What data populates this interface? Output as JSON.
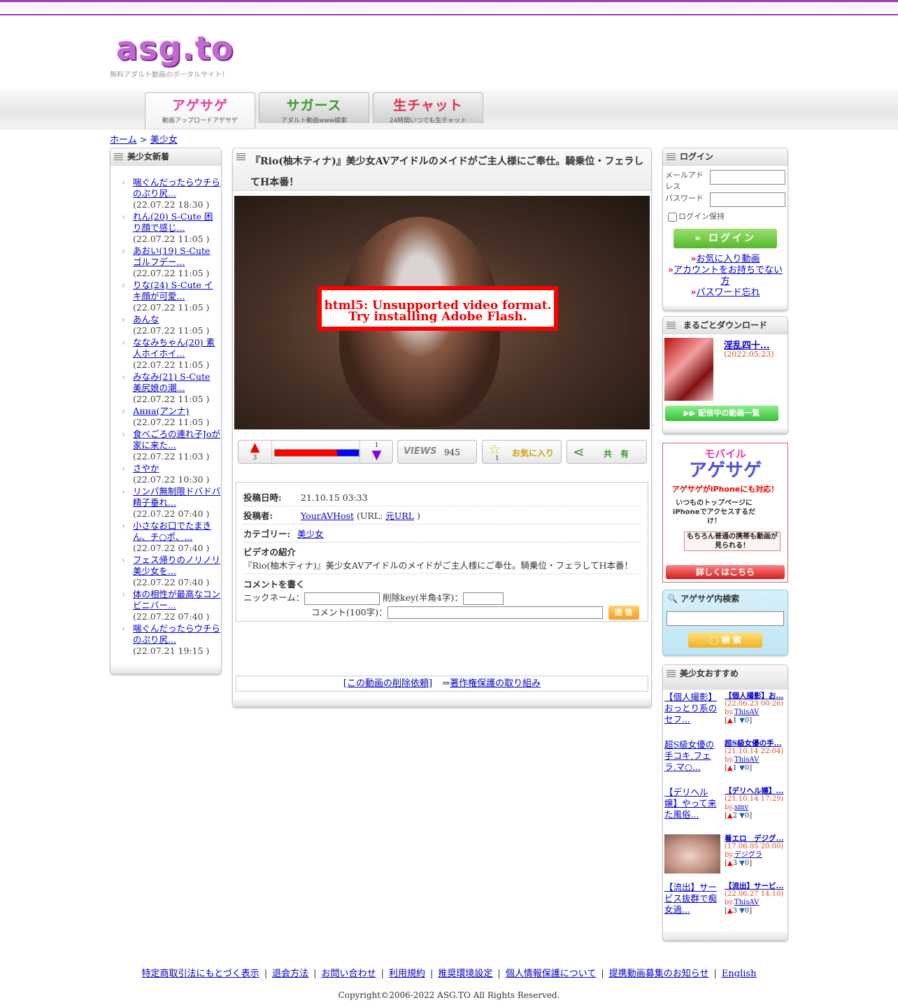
{
  "site": {
    "logo_text": "asg.to",
    "tagline": "無料アダルト動画のポータルサイト！"
  },
  "nav": {
    "tabs": [
      {
        "label": "アゲサゲ",
        "sub": "動画アップロードアゲサゲ"
      },
      {
        "label": "サガース",
        "sub": "アダルト動画www検索"
      },
      {
        "label": "生チャット",
        "sub": "24時間いつでも生チャット"
      }
    ]
  },
  "breadcrumb": {
    "home": "ホーム",
    "sep": ">",
    "current": "美少女"
  },
  "left": {
    "title": "美少女新着",
    "items": [
      {
        "title": "喘ぐんだったらウチらのぷり尻...",
        "date": "(22.07.22 18:30 )"
      },
      {
        "title": "れん(20) S-Cute 困り顔で感じ...",
        "date": "(22.07.22 11:05 )"
      },
      {
        "title": "あおい(19) S-Cute ゴルフデー...",
        "date": "(22.07.22 11:05 )"
      },
      {
        "title": "りな(24) S-Cute イキ顔が可愛...",
        "date": "(22.07.22 11:05 )"
      },
      {
        "title": "あんな",
        "date": "(22.07.22 11:05 )"
      },
      {
        "title": "ななみちゃん(20) 素人ホイホイ...",
        "date": "(22.07.22 11:05 )"
      },
      {
        "title": "みなみ(21) S-Cute 美尻娘の潮...",
        "date": "(22.07.22 11:05 )"
      },
      {
        "title": "Анна(アンナ)",
        "date": "(22.07.22 11:05 )"
      },
      {
        "title": "食べごろの連れ子Joが家に来た...",
        "date": "(22.07.22 11:03 )"
      },
      {
        "title": "さやか",
        "date": "(22.07.22 10:30 )"
      },
      {
        "title": "リンパ無制限ドバドバ精子垂れ...",
        "date": "(22.07.22 07:40 )"
      },
      {
        "title": "小さなお口でたまきん、チ○ポ、...",
        "date": "(22.07.22 07:40 )"
      },
      {
        "title": "フェス帰りのノリノリ美少女を...",
        "date": "(22.07.22 07:40 )"
      },
      {
        "title": "体の相性が最高なコンビニバー...",
        "date": "(22.07.22 07:40 )"
      },
      {
        "title": "喘ぐんだったらウチらのぷり尻...",
        "date": "(22.07.21 19:15 )"
      }
    ]
  },
  "video": {
    "title": "『Rio(柚木ティナ)』美少女AVアイドルのメイドがご主人様にご奉仕。騎乗位・フェラしてH本番！",
    "error_line1": "html5: Unsupported video format.",
    "error_line2": "Try installing Adobe Flash.",
    "up_count": "3",
    "down_count": "1",
    "views_label": "VIEWS",
    "views": "945",
    "fav_label": "お気に入り",
    "fav_count": "1",
    "share_label": "共　有",
    "rating_fraction_up": 0.74
  },
  "info": {
    "posted_label": "投稿日時:",
    "posted": "21.10.15 03:33",
    "poster_label": "投稿者:",
    "poster": "YourAVHost",
    "url_prefix": "(URL: ",
    "url_link": "元URL",
    "url_suffix": " )",
    "category_label": "カテゴリー:",
    "category": "美少女",
    "intro_label": "ビデオの紹介",
    "intro": "『Rio(柚木ティナ)』美少女AVアイドルのメイドがご主人様にご奉仕。騎乗位・フェラしてH本番！",
    "comment_label": "コメントを書く",
    "nick_label": "ニックネーム：",
    "delkey_label": "削除key(半角4字)：",
    "comment_field_label": "コメント(100字)：",
    "send_label": "送 信"
  },
  "bottom_links": {
    "delete_request": "[この動画の削除依頼]",
    "arrow": "⇒",
    "copyright_link": "著作権保護の取り組み"
  },
  "login": {
    "title": "ログイン",
    "email_label": "メールアドレス",
    "password_label": "パスワード",
    "keep_label": "ログイン保持",
    "button": "ログイン",
    "links": [
      "お気に入り動画",
      "アカウントをお持ちでない方",
      "パスワード忘れ"
    ]
  },
  "download": {
    "title": "まるごとダウンロード",
    "item_title": "淫乱四十...",
    "item_date": "(2022.05.23)",
    "button": "▶▶ 配信中の動画一覧"
  },
  "mobile_banner": {
    "line1": "モバイル",
    "line2": "アゲサゲ",
    "line3": "アゲサゲがiPhoneにも対応！",
    "line4": "いつものトップページに iPhoneでアクセスするだけ！",
    "line5": "もちろん普通の携帯も動画が見られる！",
    "line6": "詳しくはこちら"
  },
  "search": {
    "title": "アゲサゲ内検索",
    "button": "検 索"
  },
  "recommend": {
    "title": "美少女おすすめ",
    "items": [
      {
        "thumb": "【個人撮影】おっとり系のセフ...",
        "title": "【個人撮影】お...",
        "date": "(22.06.23 00:26)",
        "by_label": "by.",
        "by": "ThisAV",
        "up": "1",
        "down": "0"
      },
      {
        "thumb": "超S級女優の手コキ.フェラ.マ○...",
        "title": "超S級女優の手...",
        "date": "(21.10.14 22:04)",
        "by_label": "by.",
        "by": "ThisAV",
        "up": "1",
        "down": "0"
      },
      {
        "thumb": "【デリヘル嬢】やって来た風俗...",
        "title": "【デリヘル嬢】...",
        "date": "(21.10.14 17:29)",
        "by_label": "by.",
        "by": "smv",
        "up": "2",
        "down": "0"
      },
      {
        "thumb": "",
        "title": "着エロ　デジグ...",
        "date": "(17.06.05 20:00)",
        "by_label": "by.",
        "by": "デジグラ",
        "up": "3",
        "down": "0"
      },
      {
        "thumb": "【流出】サービス抜群で痴女過...",
        "title": "【流出】サービ...",
        "date": "(22.06.27 14:10)",
        "by_label": "by.",
        "by": "ThisAV",
        "up": "3",
        "down": "0"
      }
    ]
  },
  "footer": {
    "links": [
      "特定商取引法にもとづく表示",
      "退会方法",
      "お問い合わせ",
      "利用規約",
      "推奨環境設定",
      "個人情報保護について",
      "提携動画募集のお知らせ",
      "English"
    ],
    "copyright": "Copyright©2006-2022 ASG.TO All Rights Reserved."
  },
  "colors": {
    "brand": "#a040b0",
    "link": "#0000cc",
    "error": "#ff0000",
    "login_button": "#55b82c"
  }
}
